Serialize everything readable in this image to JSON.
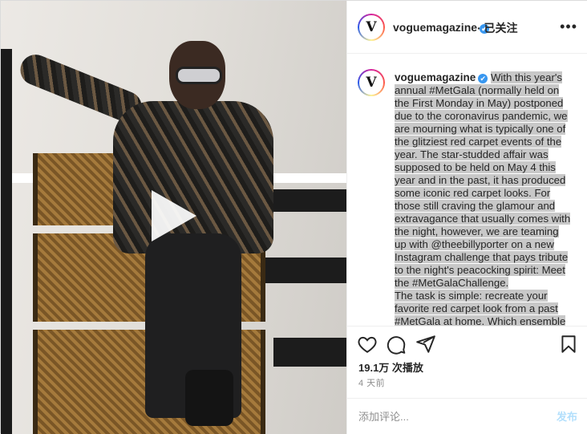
{
  "post": {
    "username": "voguemagazine",
    "verified_mark": "✔",
    "follow_status": "· 已关注",
    "more_icon": "more-options-icon",
    "avatar_letter": "V"
  },
  "caption": {
    "username": "voguemagazine",
    "text_part1": "With this year's annual #MetGala (normally held on the First Monday in May) postponed due to the coronavirus pandemic, we are mourning what is typically one of the glitziest red carpet events of the year. The star-studded affair was supposed to be held on May 4 this year and in the past, it has produced some iconic red carpet looks. For those still craving the glamour and extravagance that usually comes with the night, however, we are teaming up with @theebillyporter on a new Instagram challenge that pays tribute to the night's peacocking spirit: Meet the #MetGalaChallenge.",
    "text_part2": "The task is simple: recreate your favorite red carpet look from a past #MetGala at home. Which ensemble"
  },
  "actions": {
    "icons": [
      "heart-icon",
      "comment-icon",
      "share-icon",
      "bookmark-icon"
    ],
    "views": "19.1万 次播放",
    "time": "4 天前"
  },
  "comment": {
    "placeholder": "添加评论...",
    "post_label": "发布"
  },
  "colors": {
    "accent": "#3897f0",
    "post_disabled": "#b2dffc",
    "muted": "#8e8e8e"
  }
}
